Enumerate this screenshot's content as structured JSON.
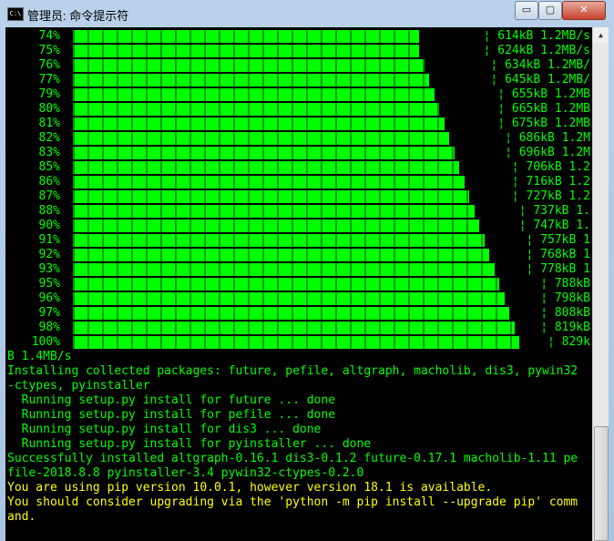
{
  "window": {
    "title": "管理员: 命令提示符",
    "icon_text": "C:\\",
    "minimize_symbol": "▭",
    "maximize_symbol": "▢",
    "close_symbol": "✕"
  },
  "progress_rows": [
    {
      "pct": "74%",
      "stat": "¦ 614kB 1.2MB/s",
      "fill": 0.74
    },
    {
      "pct": "75%",
      "stat": "¦ 624kB 1.2MB/s",
      "fill": 0.75
    },
    {
      "pct": "76%",
      "stat": "¦ 634kB 1.2MB/",
      "fill": 0.76
    },
    {
      "pct": "77%",
      "stat": "¦ 645kB 1.2MB/",
      "fill": 0.77
    },
    {
      "pct": "79%",
      "stat": "¦ 655kB 1.2MB",
      "fill": 0.79
    },
    {
      "pct": "80%",
      "stat": "¦ 665kB 1.2MB",
      "fill": 0.8
    },
    {
      "pct": "81%",
      "stat": "¦ 675kB 1.2MB",
      "fill": 0.81
    },
    {
      "pct": "82%",
      "stat": "¦ 686kB 1.2M",
      "fill": 0.82
    },
    {
      "pct": "83%",
      "stat": "¦ 696kB 1.2M",
      "fill": 0.83
    },
    {
      "pct": "85%",
      "stat": "¦ 706kB 1.2",
      "fill": 0.85
    },
    {
      "pct": "86%",
      "stat": "¦ 716kB 1.2",
      "fill": 0.86
    },
    {
      "pct": "87%",
      "stat": "¦ 727kB 1.2",
      "fill": 0.87
    },
    {
      "pct": "88%",
      "stat": "¦ 737kB 1.",
      "fill": 0.88
    },
    {
      "pct": "90%",
      "stat": "¦ 747kB 1.",
      "fill": 0.9
    },
    {
      "pct": "91%",
      "stat": "¦ 757kB 1",
      "fill": 0.91
    },
    {
      "pct": "92%",
      "stat": "¦ 768kB 1",
      "fill": 0.92
    },
    {
      "pct": "93%",
      "stat": "¦ 778kB 1",
      "fill": 0.93
    },
    {
      "pct": "95%",
      "stat": "¦ 788kB",
      "fill": 0.95
    },
    {
      "pct": "96%",
      "stat": "¦ 798kB",
      "fill": 0.96
    },
    {
      "pct": "97%",
      "stat": "¦ 808kB",
      "fill": 0.97
    },
    {
      "pct": "98%",
      "stat": "¦ 819kB",
      "fill": 0.98
    },
    {
      "pct": "100%",
      "stat": "¦ 829k",
      "fill": 1.0
    }
  ],
  "output_lines": [
    {
      "text": "B 1.4MB/s",
      "color": "green"
    },
    {
      "text": "Installing collected packages: future, pefile, altgraph, macholib, dis3, pywin32",
      "color": "green"
    },
    {
      "text": "-ctypes, pyinstaller",
      "color": "green"
    },
    {
      "text": "  Running setup.py install for future ... done",
      "color": "green"
    },
    {
      "text": "  Running setup.py install for pefile ... done",
      "color": "green"
    },
    {
      "text": "  Running setup.py install for dis3 ... done",
      "color": "green"
    },
    {
      "text": "  Running setup.py install for pyinstaller ... done",
      "color": "green"
    },
    {
      "text": "Successfully installed altgraph-0.16.1 dis3-0.1.2 future-0.17.1 macholib-1.11 pe",
      "color": "green"
    },
    {
      "text": "file-2018.8.8 pyinstaller-3.4 pywin32-ctypes-0.2.0",
      "color": "green"
    },
    {
      "text": "You are using pip version 10.0.1, however version 18.1 is available.",
      "color": "yellow"
    },
    {
      "text": "You should consider upgrading via the 'python -m pip install --upgrade pip' comm",
      "color": "yellow"
    },
    {
      "text": "and.",
      "color": "yellow"
    }
  ],
  "colors": {
    "console_bg": "#000000",
    "bar_green": "#00ff00",
    "text_green": "#00ff00",
    "warn_yellow": "#ffff00"
  }
}
